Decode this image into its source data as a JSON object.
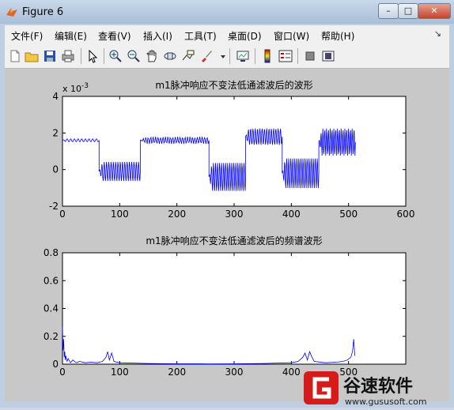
{
  "window": {
    "title": "Figure 6",
    "minimize": "–",
    "maximize": "□",
    "close": "✕"
  },
  "menu": [
    "文件(F)",
    "编辑(E)",
    "查看(V)",
    "插入(I)",
    "工具(T)",
    "桌面(D)",
    "窗口(W)",
    "帮助(H)"
  ],
  "menu_dock": "↘",
  "toolbar": [
    "new-file-icon",
    "open-folder-icon",
    "save-icon",
    "print-icon",
    "pointer-icon",
    "zoom-in-icon",
    "zoom-out-icon",
    "pan-hand-icon",
    "rotate-3d-icon",
    "data-cursor-icon",
    "brush-icon",
    "brush-dropdown-icon",
    "link-plot-icon",
    "colorbar-icon",
    "legend-icon",
    "hide-plot-tools-icon",
    "show-plot-tools-icon"
  ],
  "watermark": {
    "brand": "谷速软件",
    "url": "www.gususoft.com"
  },
  "chart_data": [
    {
      "type": "line",
      "title": "m1脉冲响应不变法低通滤波后的波形",
      "exponent_label": "x 10",
      "exponent_power": "-3",
      "xlim": [
        0,
        600
      ],
      "ylim": [
        -2,
        4
      ],
      "xticks": [
        "0",
        "100",
        "200",
        "300",
        "400",
        "500",
        "600"
      ],
      "yticks": [
        "-2",
        "0",
        "2",
        "4"
      ],
      "grid": false,
      "series_color": "#0000ff",
      "segments": [
        {
          "x_from": 0,
          "x_to": 64,
          "level": 1.6,
          "amp": 0.08,
          "cycles": 10
        },
        {
          "x_from": 64,
          "x_to": 136,
          "level": -0.1,
          "amp": 0.55,
          "cycles": 18
        },
        {
          "x_from": 136,
          "x_to": 256,
          "level": 1.6,
          "amp": 0.2,
          "cycles": 28
        },
        {
          "x_from": 256,
          "x_to": 320,
          "level": -0.4,
          "amp": 0.8,
          "cycles": 18
        },
        {
          "x_from": 320,
          "x_to": 384,
          "level": 1.8,
          "amp": 0.45,
          "cycles": 16
        },
        {
          "x_from": 384,
          "x_to": 448,
          "level": -0.2,
          "amp": 0.85,
          "cycles": 18
        },
        {
          "x_from": 448,
          "x_to": 512,
          "level": 1.5,
          "amp": 0.75,
          "cycles": 20
        }
      ]
    },
    {
      "type": "line",
      "title": "m1脉冲响应不变法低通滤波后的频谱波形",
      "xlim": [
        0,
        600
      ],
      "ylim": [
        0,
        0.8
      ],
      "xticks": [
        "0",
        "100",
        "200",
        "300",
        "400",
        "500"
      ],
      "yticks": [
        "0",
        "0.2",
        "0.4",
        "0.6",
        "0.8"
      ],
      "grid": false,
      "series_color": "#0000ff",
      "points": [
        [
          0,
          0.27
        ],
        [
          1,
          0.1
        ],
        [
          2,
          0.18
        ],
        [
          3,
          0.05
        ],
        [
          4,
          0.09
        ],
        [
          5,
          0.03
        ],
        [
          6,
          0.06
        ],
        [
          8,
          0.02
        ],
        [
          10,
          0.04
        ],
        [
          14,
          0.01
        ],
        [
          18,
          0.03
        ],
        [
          24,
          0.01
        ],
        [
          30,
          0.02
        ],
        [
          40,
          0.01
        ],
        [
          50,
          0.015
        ],
        [
          60,
          0.01
        ],
        [
          70,
          0.02
        ],
        [
          76,
          0.05
        ],
        [
          79,
          0.09
        ],
        [
          82,
          0.03
        ],
        [
          86,
          0.08
        ],
        [
          90,
          0.02
        ],
        [
          100,
          0.01
        ],
        [
          150,
          0.005
        ],
        [
          200,
          0.003
        ],
        [
          256,
          0.002
        ],
        [
          300,
          0.003
        ],
        [
          350,
          0.005
        ],
        [
          400,
          0.01
        ],
        [
          412,
          0.02
        ],
        [
          420,
          0.05
        ],
        [
          424,
          0.08
        ],
        [
          428,
          0.03
        ],
        [
          432,
          0.09
        ],
        [
          436,
          0.05
        ],
        [
          440,
          0.02
        ],
        [
          460,
          0.01
        ],
        [
          480,
          0.015
        ],
        [
          490,
          0.02
        ],
        [
          498,
          0.03
        ],
        [
          504,
          0.05
        ],
        [
          507,
          0.09
        ],
        [
          509,
          0.18
        ],
        [
          510,
          0.12
        ],
        [
          511,
          0.06
        ]
      ]
    }
  ]
}
